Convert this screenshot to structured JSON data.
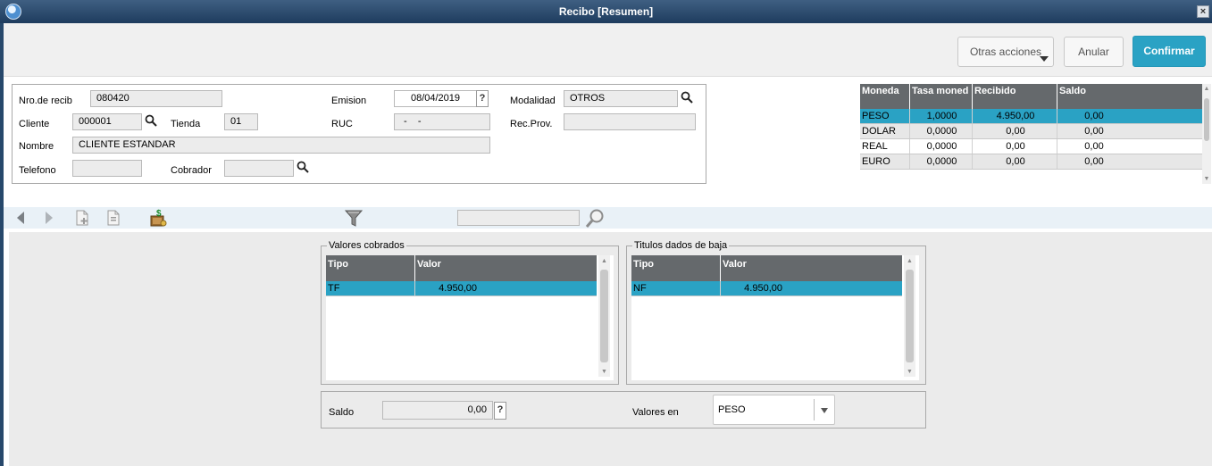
{
  "window": {
    "title": "Recibo [Resumen]",
    "close_glyph": "×"
  },
  "actions": {
    "more": "Otras acciones",
    "cancel": "Anular",
    "confirm": "Confirmar"
  },
  "header": {
    "receipt_label": "Nro.de recib",
    "receipt_value": "080420",
    "client_label": "Cliente",
    "client_value": "000001",
    "store_label": "Tienda",
    "store_value": "01",
    "name_label": "Nombre",
    "name_value": "CLIENTE ESTANDAR",
    "phone_label": "Telefono",
    "phone_value": "",
    "collector_label": "Cobrador",
    "collector_value": "",
    "emission_label": "Emision",
    "emission_value": "08/04/2019",
    "emission_help": "?",
    "ruc_label": "RUC",
    "ruc_value": "-    -",
    "modality_label": "Modalidad",
    "modality_value": "OTROS",
    "recprov_label": "Rec.Prov.",
    "recprov_value": ""
  },
  "currency_grid": {
    "columns": [
      "Moneda",
      "Tasa moned",
      "Recibido",
      "Saldo"
    ],
    "rows": [
      [
        "PESO",
        "1,0000",
        "4.950,00",
        "0,00"
      ],
      [
        "DOLAR",
        "0,0000",
        "0,00",
        "0,00"
      ],
      [
        "REAL",
        "0,0000",
        "0,00",
        "0,00"
      ],
      [
        "EURO",
        "0,0000",
        "0,00",
        "0,00"
      ]
    ]
  },
  "toolbar": {
    "search_value": ""
  },
  "collected": {
    "title": "Valores cobrados",
    "columns": [
      "Tipo",
      "Valor"
    ],
    "rows": [
      [
        "TF",
        "4.950,00"
      ]
    ]
  },
  "written_off": {
    "title": "Titulos dados de baja",
    "columns": [
      "Tipo",
      "Valor"
    ],
    "rows": [
      [
        "NF",
        "4.950,00"
      ]
    ]
  },
  "footer": {
    "balance_label": "Saldo",
    "balance_value": "0,00",
    "balance_help": "?",
    "values_in_label": "Valores en",
    "values_in_value": "PESO"
  },
  "colors": {
    "accent": "#2aa2c4",
    "grid_header": "#65696c",
    "frame": "#27486b"
  }
}
